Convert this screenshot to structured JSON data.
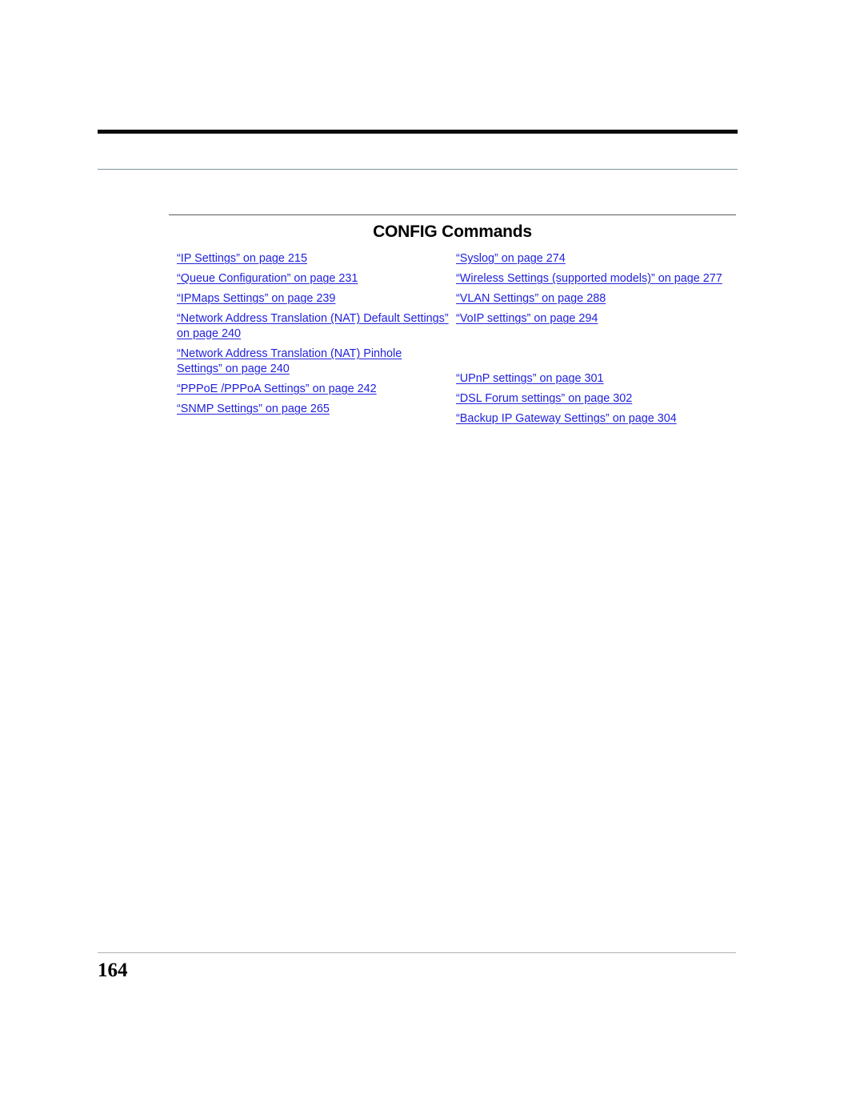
{
  "document": {
    "title": "CONFIG Commands",
    "folio": "164",
    "link_color": "#2222DD",
    "rule_colors": {
      "top_thick": "#0A0A0A",
      "top_thin": "#7F9698",
      "title_rule": "#5A5A5A",
      "footer_rule": "#B0B0B0"
    }
  },
  "cross_references": {
    "left_column": [
      {
        "text": "“IP Settings” on page 215",
        "target_page": "215",
        "wraps": false
      },
      {
        "text": "“Queue Configuration” on page 231",
        "target_page": "231",
        "wraps": false
      },
      {
        "text": "“IPMaps Settings” on page 239",
        "target_page": "239",
        "wraps": false
      },
      {
        "text": "“Network Address Translation (NAT) Default Settings” on page 240",
        "target_page": "240",
        "wraps": true
      },
      {
        "text": "“Network Address Translation (NAT) Pinhole Settings” on page 240",
        "target_page": "240",
        "wraps": true
      },
      {
        "text": "“PPPoE /PPPoA Settings” on page 242",
        "target_page": "242",
        "wraps": false
      },
      {
        "text": "“SNMP Settings” on page 265",
        "target_page": "265",
        "wraps": false
      }
    ],
    "right_column": [
      {
        "text": "“Syslog” on page 274",
        "target_page": "274",
        "wraps": false
      },
      {
        "text": "“Wireless Settings (supported models)” on page 277",
        "target_page": "277",
        "wraps": false
      },
      {
        "text": "“VLAN Settings” on page 288",
        "target_page": "288",
        "wraps": false
      },
      {
        "text": "“VoIP settings” on page 294",
        "target_page": "294",
        "wraps": false
      },
      {
        "text": "“UPnP settings” on page 301",
        "target_page": "301",
        "wraps": false
      },
      {
        "text": "“DSL Forum settings” on page 302",
        "target_page": "302",
        "wraps": false
      },
      {
        "text": "“Backup IP Gateway Settings” on page 304",
        "target_page": "304",
        "wraps": false
      }
    ]
  }
}
